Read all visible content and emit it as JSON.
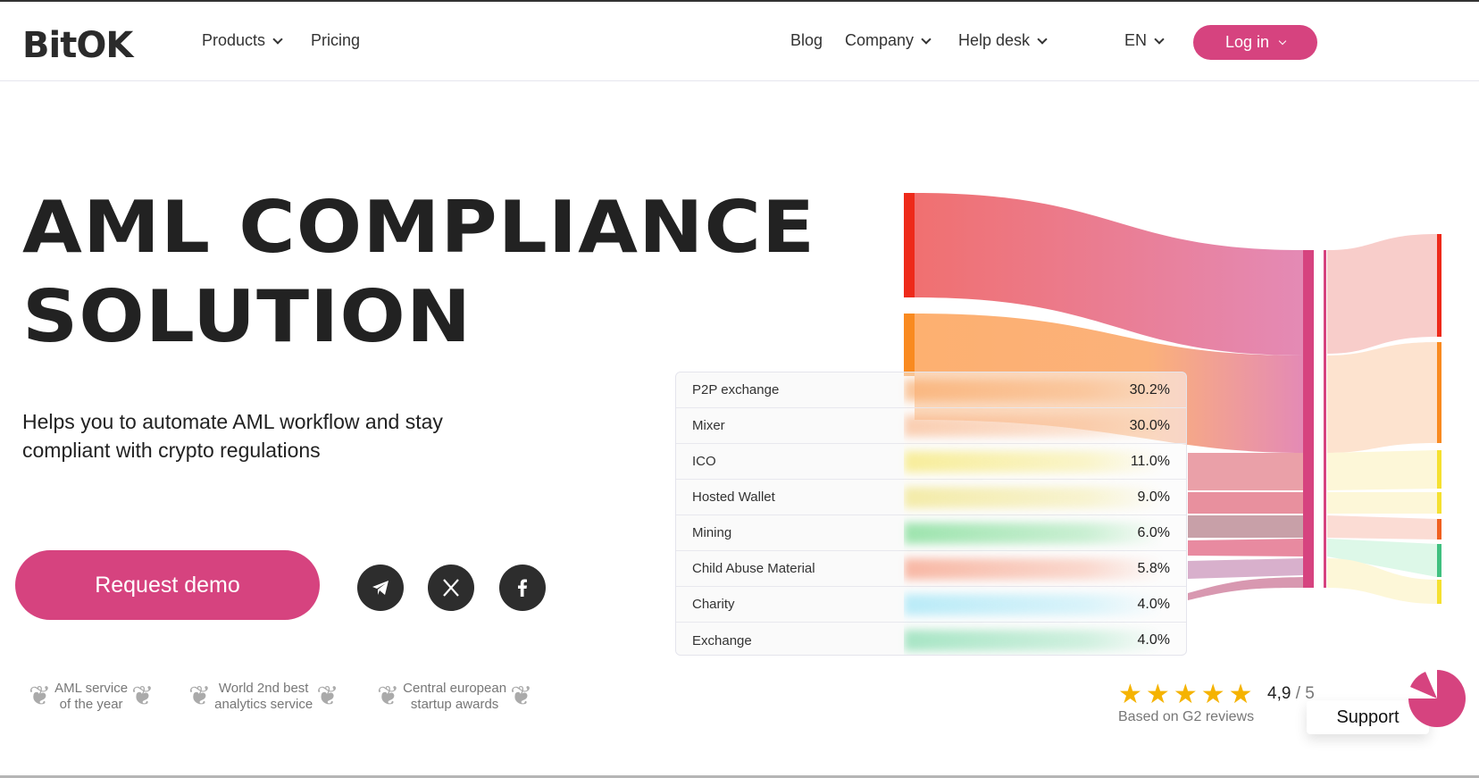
{
  "header": {
    "logo": "BitOK",
    "nav_left": [
      {
        "label": "Products",
        "dropdown": true
      },
      {
        "label": "Pricing",
        "dropdown": false
      }
    ],
    "nav_right": [
      {
        "label": "Blog",
        "dropdown": false
      },
      {
        "label": "Company",
        "dropdown": true
      },
      {
        "label": "Help desk",
        "dropdown": true
      }
    ],
    "language": "EN",
    "login_label": "Log in"
  },
  "hero": {
    "title_line1": "AML COMPLIANCE",
    "title_line2": "SOLUTION",
    "subtitle": "Helps you to automate AML workflow and stay compliant with crypto regulations",
    "cta": "Request demo",
    "social": [
      "telegram-icon",
      "x-icon",
      "facebook-icon"
    ],
    "awards": [
      {
        "line1": "AML service",
        "line2": "of the year"
      },
      {
        "line1": "World 2nd best",
        "line2": "analytics service"
      },
      {
        "line1": "Central european",
        "line2": "startup awards"
      }
    ]
  },
  "risk_table": {
    "rows": [
      {
        "label": "P2P exchange",
        "value": "30.2%",
        "color": "#f9a25a"
      },
      {
        "label": "Mixer",
        "value": "30.0%",
        "color": "#f9b080"
      },
      {
        "label": "ICO",
        "value": "11.0%",
        "color": "#f5e45a"
      },
      {
        "label": "Hosted Wallet",
        "value": "9.0%",
        "color": "#eee070"
      },
      {
        "label": "Mining",
        "value": "6.0%",
        "color": "#5ed47a"
      },
      {
        "label": "Child Abuse Material",
        "value": "5.8%",
        "color": "#f58a6a"
      },
      {
        "label": "Charity",
        "value": "4.0%",
        "color": "#8ee0f5"
      },
      {
        "label": "Exchange",
        "value": "4.0%",
        "color": "#6fd6a0"
      }
    ]
  },
  "reviews": {
    "rating": "4,9",
    "max": "/ 5",
    "stars": 5,
    "caption": "Based on G2 reviews"
  },
  "support": {
    "label": "Support"
  },
  "colors": {
    "accent": "#d6437f"
  }
}
